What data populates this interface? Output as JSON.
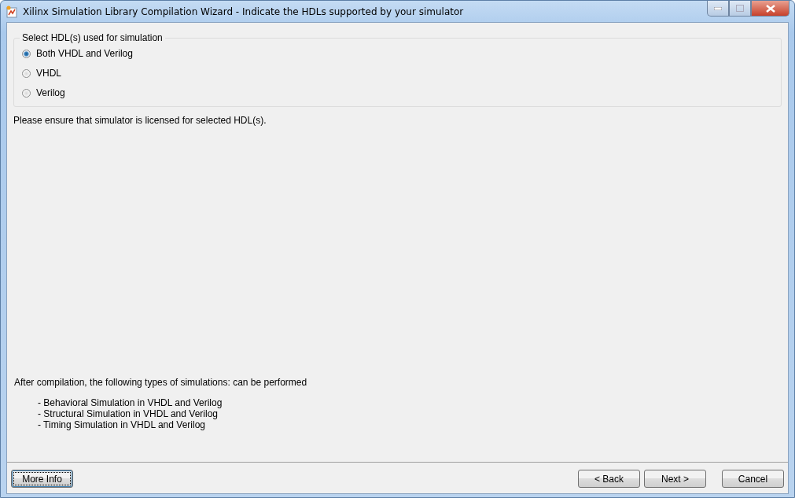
{
  "window": {
    "title": "Xilinx Simulation Library Compilation Wizard - Indicate the HDLs supported by your simulator"
  },
  "hdl_group": {
    "legend": "Select HDL(s) used for simulation",
    "options": [
      {
        "label": "Both VHDL and Verilog",
        "selected": true
      },
      {
        "label": "VHDL",
        "selected": false
      },
      {
        "label": "Verilog",
        "selected": false
      }
    ]
  },
  "notice": "Please ensure that simulator is licensed for selected HDL(s).",
  "summary": {
    "heading": "After compilation,  the following types of simulations: can be performed",
    "items": [
      "- Behavioral Simulation in VHDL and Verilog",
      "- Structural Simulation in VHDL and Verilog",
      "- Timing Simulation in VHDL and Verilog"
    ]
  },
  "left_buttons": [
    {
      "label": "More Info",
      "focused": true
    }
  ],
  "right_buttons": [
    {
      "label": "< Back",
      "focused": false
    },
    {
      "label": "Next >",
      "focused": false
    },
    {
      "label": "Cancel",
      "focused": false
    }
  ]
}
